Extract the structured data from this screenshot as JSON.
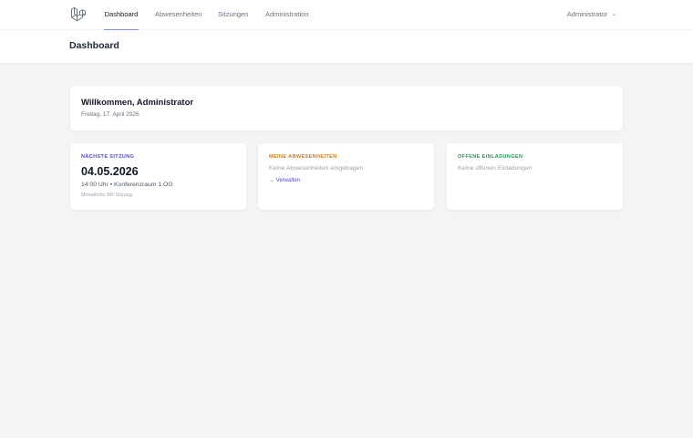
{
  "nav": {
    "items": [
      {
        "label": "Dashboard",
        "active": true
      },
      {
        "label": "Abwesenheiten",
        "active": false
      },
      {
        "label": "Sitzungen",
        "active": false
      },
      {
        "label": "Administration",
        "active": false
      }
    ],
    "user": "Administrator",
    "logo_icon": "laravel-logo-icon",
    "chevron_icon": "chevron-down-icon"
  },
  "header": {
    "title": "Dashboard"
  },
  "welcome": {
    "title": "Willkommen, Administrator",
    "date": "Freitag, 17. April 2026"
  },
  "cards": {
    "next_meeting": {
      "heading": "NÄCHSTE SITZUNG",
      "date": "04.05.2026",
      "time_place": "14:00 Uhr • Konferenzraum 1.OG",
      "description": "Monatliche BR-Sitzung"
    },
    "absences": {
      "heading": "MEINE ABWESENHEITEN",
      "empty": "Keine Abwesenheiten eingetragen",
      "link": "→ Verwalten"
    },
    "invitations": {
      "heading": "OFFENE EINLADUNGEN",
      "empty": "Keine offenen Einladungen"
    }
  },
  "colors": {
    "accent": "#818cf8",
    "link": "#4f46e5",
    "meeting_heading": "#4f46e5",
    "absences_heading": "#d97706",
    "invitations_heading": "#16a34a"
  }
}
